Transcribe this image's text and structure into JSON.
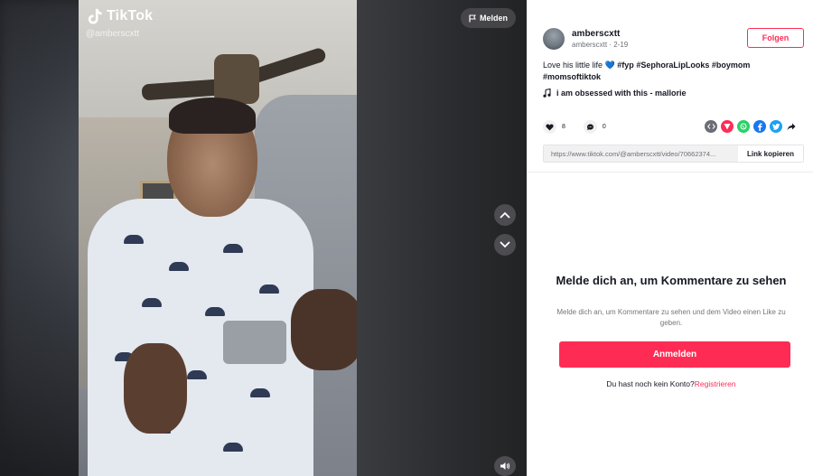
{
  "video": {
    "brand": "TikTok",
    "handle": "@amberscxtt",
    "report_label": "Melden"
  },
  "author": {
    "name": "amberscxtt",
    "meta": "amberscxtt · 2-19"
  },
  "follow_label": "Folgen",
  "caption": {
    "text": "Love his little life",
    "emoji": "💙",
    "tags": [
      "#fyp",
      "#SephoraLipLooks",
      "#boymom",
      "#momsoftiktok"
    ]
  },
  "music": "i am obsessed with this - mallorie",
  "stats": {
    "likes": "8",
    "comments": "0"
  },
  "share": {
    "icons": [
      "embed-icon",
      "send-icon",
      "whatsapp-icon",
      "facebook-icon",
      "twitter-icon",
      "share-arrow-icon"
    ],
    "colors": {
      "embed": "#6b6d75",
      "send": "#fe2c55",
      "whatsapp": "#25d366",
      "facebook": "#1877f2",
      "twitter": "#1da1f2"
    }
  },
  "link": {
    "url": "https://www.tiktok.com/@amberscxtt/video/70662374...",
    "copy_label": "Link kopieren"
  },
  "login": {
    "title": "Melde dich an, um Kommentare zu sehen",
    "subtitle": "Melde dich an, um Kommentare zu sehen und dem Video einen Like zu geben.",
    "button_label": "Anmelden",
    "no_account": "Du hast noch kein Konto?",
    "register_label": "Registrieren"
  },
  "colors": {
    "accent": "#fe2c55",
    "text": "#161823"
  }
}
